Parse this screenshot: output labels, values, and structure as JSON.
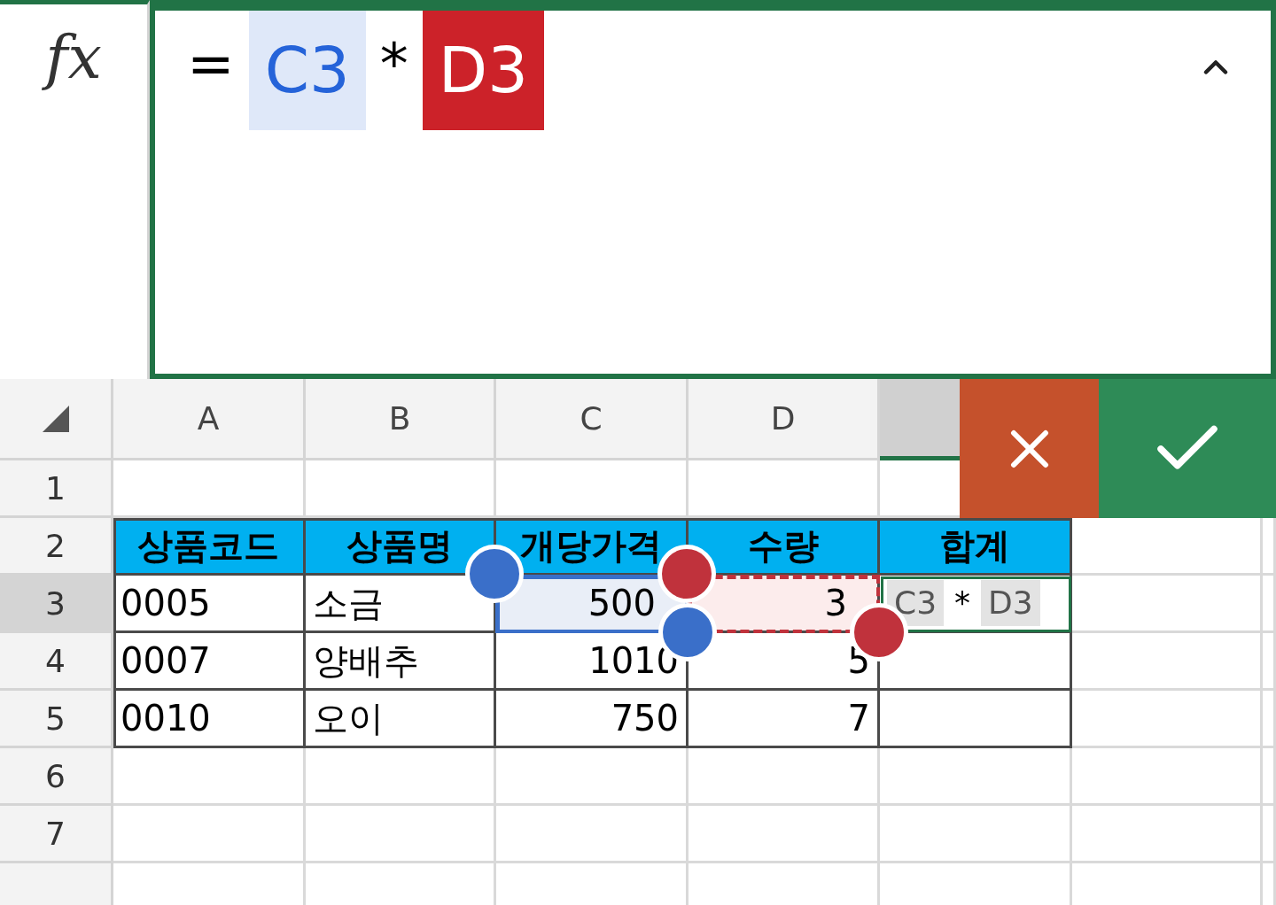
{
  "formula_bar": {
    "fx_label": "fx",
    "tokens": [
      {
        "kind": "operator",
        "text": "="
      },
      {
        "kind": "ref",
        "text": "C3",
        "color": "#2563d9",
        "filled": false
      },
      {
        "kind": "operator",
        "text": "*"
      },
      {
        "kind": "ref",
        "text": "D3",
        "color": "#cc2229",
        "filled": true
      }
    ]
  },
  "column_headers": [
    "A",
    "B",
    "C",
    "D"
  ],
  "row_headers": [
    {
      "number": "1",
      "selected": false
    },
    {
      "number": "2",
      "selected": false
    },
    {
      "number": "3",
      "selected": true
    },
    {
      "number": "4",
      "selected": false
    },
    {
      "number": "5",
      "selected": false
    },
    {
      "number": "6",
      "selected": false
    },
    {
      "number": "7",
      "selected": false
    }
  ],
  "table": {
    "columns": [
      {
        "label": "상품코드",
        "numeric": false
      },
      {
        "label": "상품명",
        "numeric": false
      },
      {
        "label": "개당가격",
        "numeric": true
      },
      {
        "label": "수량",
        "numeric": true
      },
      {
        "label": "합계",
        "numeric": false
      }
    ],
    "rows": [
      {
        "cells": [
          {
            "kind": "value",
            "text": "0005"
          },
          {
            "kind": "value",
            "text": "소금"
          },
          {
            "kind": "value",
            "text": "500",
            "highlight": {
              "color": "#3a6fc9",
              "dashed": false
            }
          },
          {
            "kind": "value",
            "text": "3",
            "highlight": {
              "color": "#c0323c",
              "dashed": true
            }
          },
          {
            "kind": "formula",
            "editing": true,
            "tokens": [
              {
                "kind": "ref",
                "text": "C3"
              },
              {
                "kind": "operator",
                "text": "*"
              },
              {
                "kind": "ref",
                "text": "D3"
              }
            ]
          }
        ]
      },
      {
        "cells": [
          {
            "kind": "value",
            "text": "0007"
          },
          {
            "kind": "value",
            "text": "양배추"
          },
          {
            "kind": "value",
            "text": "1010"
          },
          {
            "kind": "value",
            "text": "5"
          }
        ]
      },
      {
        "cells": [
          {
            "kind": "value",
            "text": "0010"
          },
          {
            "kind": "value",
            "text": "오이"
          },
          {
            "kind": "value",
            "text": "750"
          },
          {
            "kind": "value",
            "text": "7"
          }
        ]
      }
    ]
  }
}
